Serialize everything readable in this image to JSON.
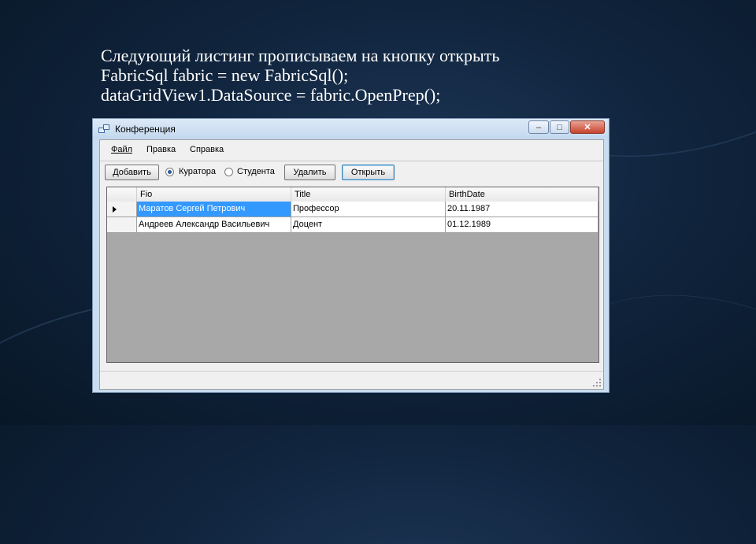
{
  "slide": {
    "line1": "Следующий листинг прописываем на кнопку открыть",
    "line2": "FabricSql fabric = new FabricSql();",
    "line3": "dataGridView1.DataSource = fabric.OpenPrep();"
  },
  "window": {
    "title": "Конференция",
    "icon": "app-window-icon",
    "controls": {
      "minimize": "–",
      "maximize": "□",
      "close": "✕"
    }
  },
  "menu": {
    "file": "Файл",
    "edit": "Правка",
    "help": "Справка"
  },
  "toolbar": {
    "add": "Добавить",
    "radio_curator": "Куратора",
    "radio_student": "Студента",
    "selected_radio": "Куратора",
    "delete": "Удалить",
    "open": "Открыть"
  },
  "grid": {
    "columns": [
      "Fio",
      "Title",
      "BirthDate"
    ],
    "rows": [
      {
        "fio": "Маратов Сергей Петрович",
        "title": "Профессор",
        "birth": "20.11.1987"
      },
      {
        "fio": "Андреев Александр Васильевич",
        "title": "Доцент",
        "birth": "01.12.1989"
      }
    ]
  }
}
